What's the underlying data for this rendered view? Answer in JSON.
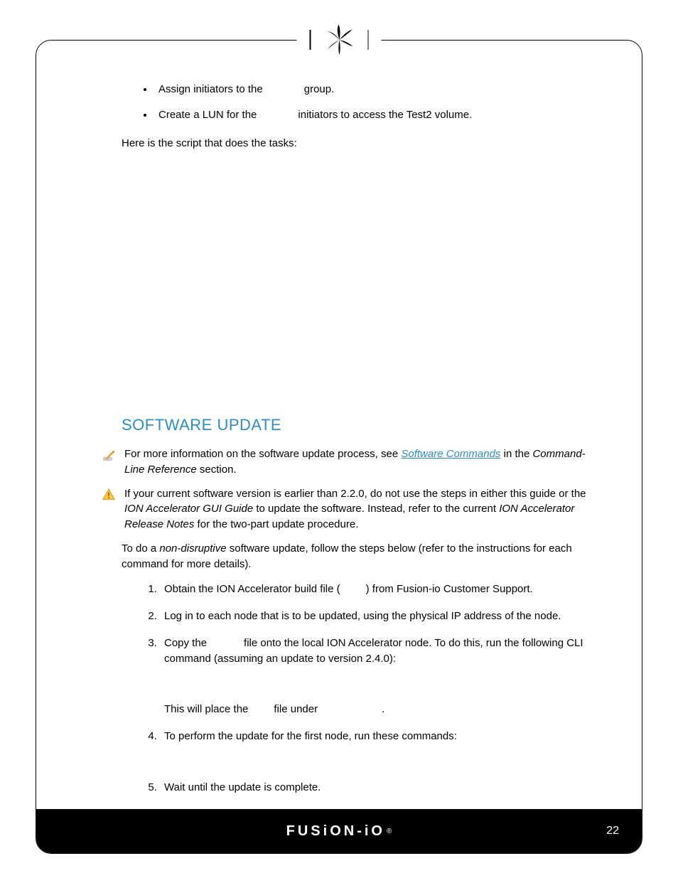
{
  "bullets": [
    {
      "pre": "Assign initiators to the",
      "post": "group."
    },
    {
      "pre": "Create a LUN for the",
      "post": "initiators to access the Test2 volume."
    }
  ],
  "intro": "Here is the script that does the tasks:",
  "section": {
    "heading": "SOFTWARE UPDATE",
    "note1_a": "For more information on the software update process, see ",
    "note1_link": "Software Commands",
    "note1_b": " in the ",
    "note1_c": "Command-Line Reference",
    "note1_d": " section.",
    "note2_a": "If your current software version is earlier than 2.2.0, do not use the steps in either this guide or the ",
    "note2_b": "ION Accelerator GUI Guide",
    "note2_c": " to update the software. Instead, refer to the current ",
    "note2_d": "ION Accelerator Release Notes",
    "note2_e": " for the two-part update procedure.",
    "lead_a": "To do a ",
    "lead_b": "non-disruptive",
    "lead_c": " software update, follow the steps below (refer to the instructions for each command for more details).",
    "steps": {
      "s1a": "Obtain the ION Accelerator build file (",
      "s1b": ") from Fusion-io Customer Support.",
      "s2": "Log in to each node that is to be updated, using the physical IP address of the node.",
      "s3a": "Copy the",
      "s3b": "file onto the local ION Accelerator node. To do this, run the following CLI command (assuming an update to version 2.4.0):",
      "s3sub_a": "This will place the",
      "s3sub_b": "file under",
      "s3sub_c": ".",
      "s4": "To perform the update for the first node, run these commands:",
      "s5": "Wait until the update is complete."
    }
  },
  "footer": {
    "brand": "FUSiON-iO",
    "page": "22"
  }
}
